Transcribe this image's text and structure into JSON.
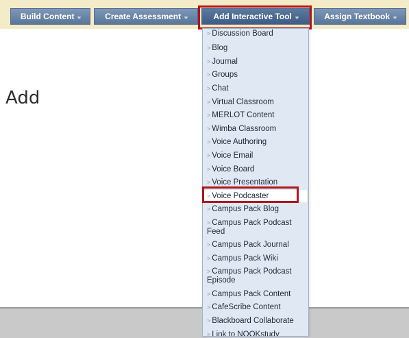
{
  "toolbar": {
    "buttons": [
      {
        "label": "Build Content"
      },
      {
        "label": "Create Assessment"
      },
      {
        "label": "Add Interactive Tool"
      },
      {
        "label": "Assign Textbook"
      }
    ]
  },
  "page": {
    "heading_fragment": "Add"
  },
  "menu": {
    "items": [
      {
        "label": "Discussion Board"
      },
      {
        "label": "Blog"
      },
      {
        "label": "Journal"
      },
      {
        "label": "Groups"
      },
      {
        "label": "Chat"
      },
      {
        "label": "Virtual Classroom"
      },
      {
        "label": "MERLOT Content"
      },
      {
        "label": "Wimba Classroom"
      },
      {
        "label": "Voice Authoring"
      },
      {
        "label": "Voice Email"
      },
      {
        "label": "Voice Board"
      },
      {
        "label": "Voice Presentation"
      },
      {
        "label": "Voice Podcaster"
      },
      {
        "label": "Campus Pack Blog"
      },
      {
        "label": "Campus Pack Podcast Feed"
      },
      {
        "label": "Campus Pack Journal"
      },
      {
        "label": "Campus Pack Wiki"
      },
      {
        "label": "Campus Pack Podcast Episode"
      },
      {
        "label": "Campus Pack Content"
      },
      {
        "label": "CafeScribe Content"
      },
      {
        "label": "Blackboard Collaborate"
      },
      {
        "label": "Link to NOOKstudy"
      }
    ]
  },
  "icons": {
    "toolbar_chevron": "double-chevron-down-icon",
    "menu_arrow": "chevron-right-icon"
  },
  "colors": {
    "toolbar_bg": "#f4ecc9",
    "button_bg": "#6a86a8",
    "menu_bg": "#dfe8f3",
    "highlight": "#b2141c"
  }
}
